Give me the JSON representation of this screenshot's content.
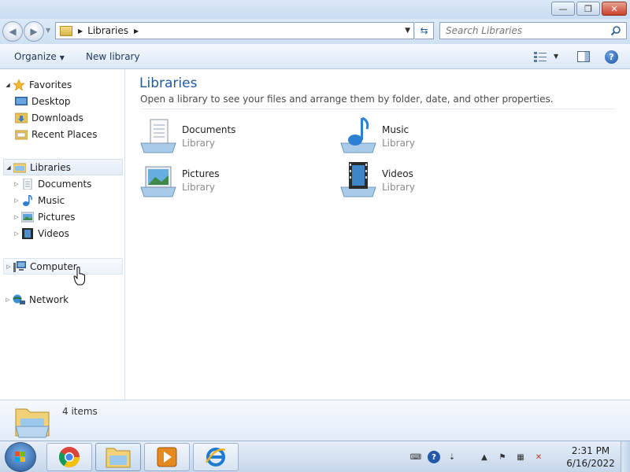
{
  "window": {
    "minimize_glyph": "—",
    "restore_glyph": "❐",
    "close_glyph": "✕"
  },
  "address": {
    "path": "Libraries",
    "search_placeholder": "Search Libraries"
  },
  "toolbar": {
    "organize_label": "Organize",
    "new_library_label": "New library"
  },
  "navigation": {
    "favorites_label": "Favorites",
    "favorites_items": [
      "Desktop",
      "Downloads",
      "Recent Places"
    ],
    "libraries_label": "Libraries",
    "libraries_items": [
      "Documents",
      "Music",
      "Pictures",
      "Videos"
    ],
    "computer_label": "Computer",
    "network_label": "Network"
  },
  "content": {
    "title": "Libraries",
    "description": "Open a library to see your files and arrange them by folder, date, and other properties.",
    "libraries": [
      {
        "name": "Documents",
        "type": "Library",
        "icon": "documents-library-icon"
      },
      {
        "name": "Music",
        "type": "Library",
        "icon": "music-library-icon"
      },
      {
        "name": "Pictures",
        "type": "Library",
        "icon": "pictures-library-icon"
      },
      {
        "name": "Videos",
        "type": "Library",
        "icon": "videos-library-icon"
      }
    ]
  },
  "details": {
    "item_count": "4 items"
  },
  "taskbar": {
    "pinned": [
      "chrome-icon",
      "explorer-icon",
      "media-player-icon",
      "internet-explorer-icon"
    ],
    "time": "2:31 PM",
    "date": "6/16/2022"
  },
  "colors": {
    "accent_title": "#1e5a9e",
    "chrome_blue": "#dce9f7"
  }
}
